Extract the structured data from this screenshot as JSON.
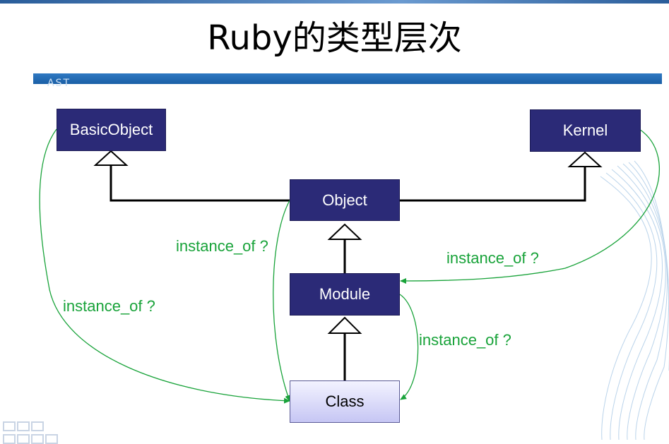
{
  "slide": {
    "title": "Ruby的类型层次",
    "logo_text": "AST"
  },
  "nodes": {
    "basic_object": "BasicObject",
    "kernel": "Kernel",
    "object": "Object",
    "module": "Module",
    "class": "Class"
  },
  "edge_labels": {
    "object_to_class": "instance_of ?",
    "kernel_to_module": "instance_of ?",
    "basic_object_to_class": "instance_of ?",
    "module_to_class": "instance_of ?"
  },
  "colors": {
    "node_fill": "#2b2a77",
    "class_fill": "#c6c6f4",
    "instance_arrow": "#19a33a",
    "inheritance_line": "#000000",
    "title_bar": "#1a5fa6"
  }
}
